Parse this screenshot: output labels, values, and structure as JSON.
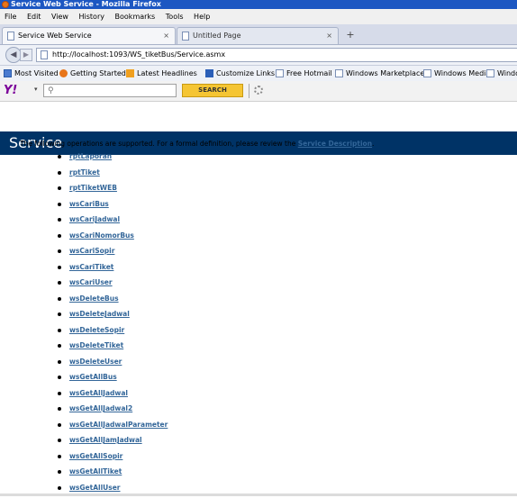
{
  "window": {
    "title": "Service Web Service - Mozilla Firefox"
  },
  "menu": [
    "File",
    "Edit",
    "View",
    "History",
    "Bookmarks",
    "Tools",
    "Help"
  ],
  "tabs": [
    {
      "label": "Service Web Service",
      "close": "×"
    },
    {
      "label": "Untitled Page",
      "close": "×"
    }
  ],
  "new_tab": "+",
  "navigation": {
    "back": "◀",
    "forward": "▶",
    "url": "http://localhost:1093/WS_tiketBus/Service.asmx"
  },
  "bookmarks": [
    "Most Visited",
    "Getting Started",
    "Latest Headlines",
    "Customize Links",
    "Free Hotmail",
    "Windows Marketplace",
    "Windows Media",
    "Windo"
  ],
  "yahoo": {
    "logo": "Y!",
    "dropdown": "▾",
    "search_icon": "⚲",
    "search_button": "SEARCH"
  },
  "page": {
    "title": "Service",
    "intro_text": "The following operations are supported. For a formal definition, please review the ",
    "intro_link": "Service Description",
    "intro_end": ".",
    "operations": [
      "rptLaporan",
      "rptTiket",
      "rptTiketWEB",
      "wsCariBus",
      "wsCariJadwal",
      "wsCariNomorBus",
      "wsCariSopir",
      "wsCariTiket",
      "wsCariUser",
      "wsDeleteBus",
      "wsDeleteJadwal",
      "wsDeleteSopir",
      "wsDeleteTiket",
      "wsDeleteUser",
      "wsGetAllBus",
      "wsGetAllJadwal",
      "wsGetAllJadwal2",
      "wsGetAllJadwalParameter",
      "wsGetAllJamJadwal",
      "wsGetAllSopir",
      "wsGetAllTiket",
      "wsGetAllUser"
    ]
  },
  "colors": {
    "page_header_bg": "#003366",
    "link": "#336699",
    "titlebar": "#1c57c2"
  }
}
